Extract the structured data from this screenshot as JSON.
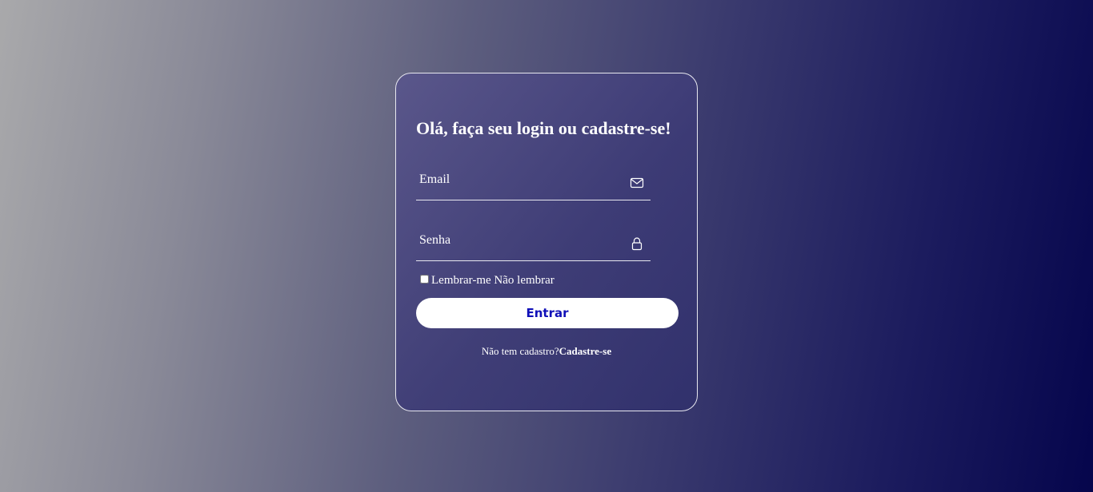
{
  "login": {
    "title": "Olá, faça seu login ou cadastre-se!",
    "email": {
      "placeholder": "Email",
      "value": "",
      "icon": "envelope-icon"
    },
    "password": {
      "placeholder": "Senha",
      "value": "",
      "icon": "lock-icon"
    },
    "remember_label": "Lembrar-me Não lembrar",
    "remember_checked": false,
    "submit_label": "Entrar",
    "signup_prompt": "Não tem cadastro?",
    "signup_link": "Cadastre-se"
  },
  "colors": {
    "button_text": "#1010b8",
    "button_bg": "#ffffff",
    "card_border": "#e8e8f0"
  }
}
